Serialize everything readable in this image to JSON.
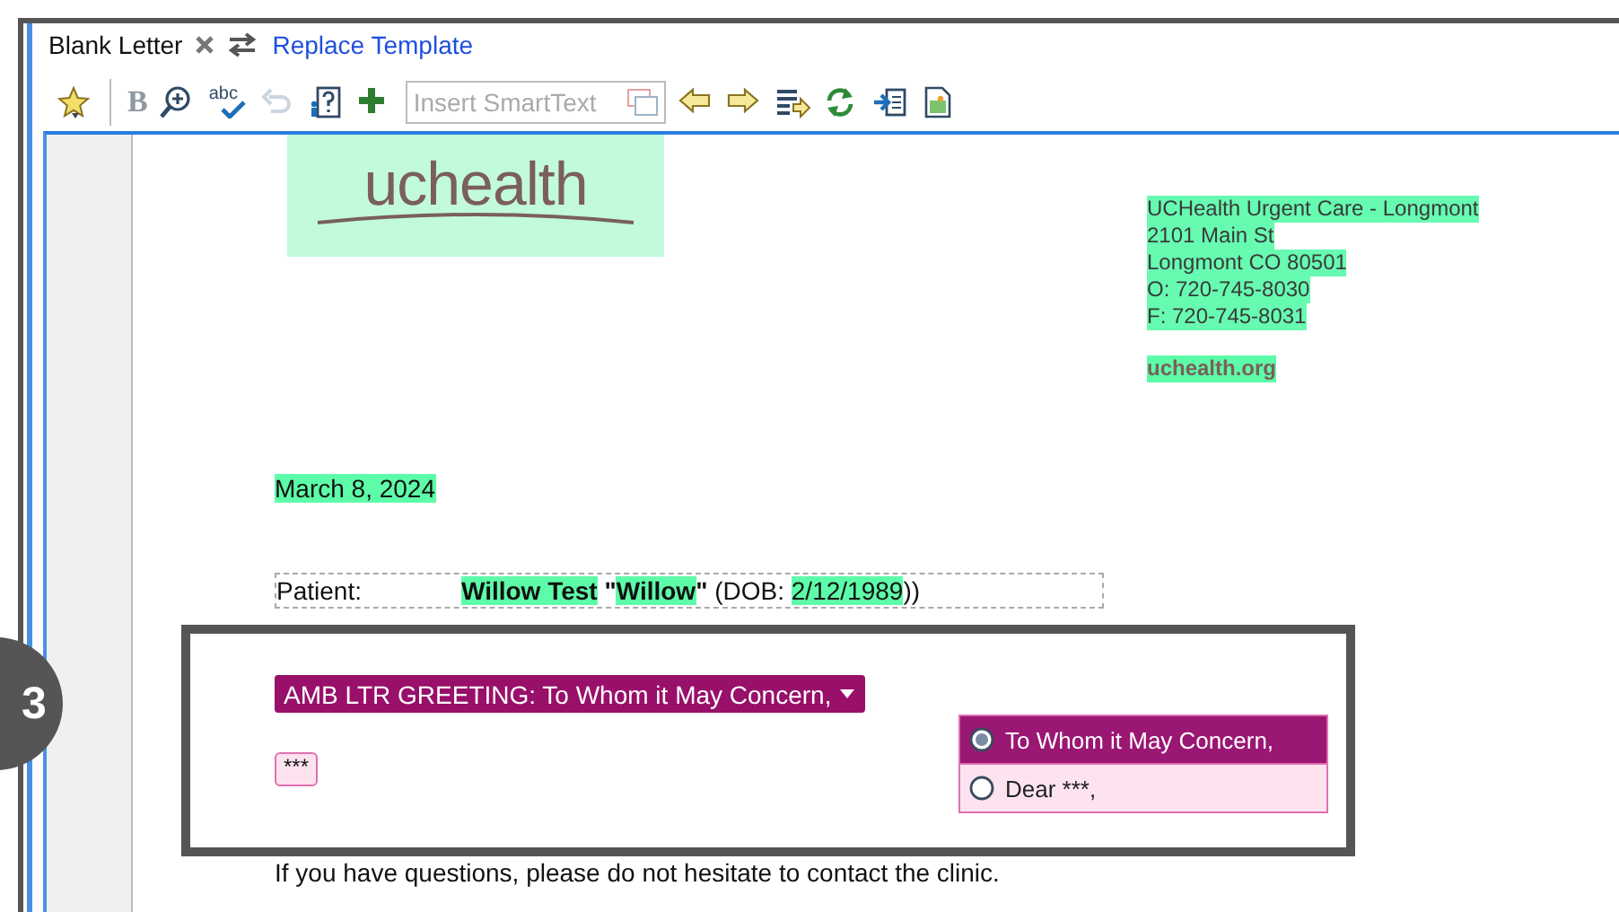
{
  "header": {
    "title": "Blank Letter",
    "link": "Replace Template"
  },
  "toolbar": [
    {
      "kind": "star",
      "disabled": false
    },
    {
      "kind": "bold",
      "label": "B",
      "disabled": true
    },
    {
      "kind": "zoom",
      "disabled": false
    },
    {
      "kind": "spell",
      "label": "abc",
      "disabled": false
    },
    {
      "kind": "undo",
      "disabled": true
    },
    {
      "kind": "help",
      "disabled": false
    },
    {
      "kind": "plus",
      "disabled": false
    },
    {
      "kind": "field",
      "placeholder": "Insert SmartText"
    },
    {
      "kind": "left",
      "disabled": false
    },
    {
      "kind": "right",
      "disabled": false
    },
    {
      "kind": "list",
      "disabled": false
    },
    {
      "kind": "refresh",
      "disabled": false
    },
    {
      "kind": "import",
      "disabled": false
    },
    {
      "kind": "image",
      "disabled": false
    }
  ],
  "letter": {
    "logo": "uchealth",
    "address": [
      {
        "text": "UCHealth Urgent Care - Longmont "
      },
      {
        "text": "2101 Main St "
      },
      {
        "text": "Longmont CO 80501 "
      },
      {
        "text": "O:  720-745-8030 "
      },
      {
        "text": "F:  720-745-8031"
      }
    ],
    "website": "uchealth.org",
    "date": "March 8, 2024",
    "patient_label": "Patient:",
    "patient": [
      {
        "text": "Willow Test",
        "bold": true,
        "highlighted": true
      },
      {
        "text": " \"",
        "bold": true,
        "highlighted": false
      },
      {
        "text": "Willow",
        "bold": true,
        "highlighted": true
      },
      {
        "text": "\"",
        "bold": true,
        "highlighted": false
      },
      {
        "text": " (DOB: ",
        "bold": false,
        "highlighted": false
      },
      {
        "text": "2/12/1989",
        "bold": false,
        "highlighted": true
      },
      {
        "text": "))",
        "bold": false,
        "highlighted": false
      }
    ],
    "greeting": "AMB LTR GREETING: To Whom it May Concern,",
    "greeting_options": [
      {
        "label": "To Whom it May Concern,",
        "selected": true
      },
      {
        "label": "Dear ***,",
        "selected": false
      }
    ],
    "placeholder_field": "***",
    "closing": "If you have questions, please do not hesitate to contact the clinic."
  },
  "step_badge": "3"
}
